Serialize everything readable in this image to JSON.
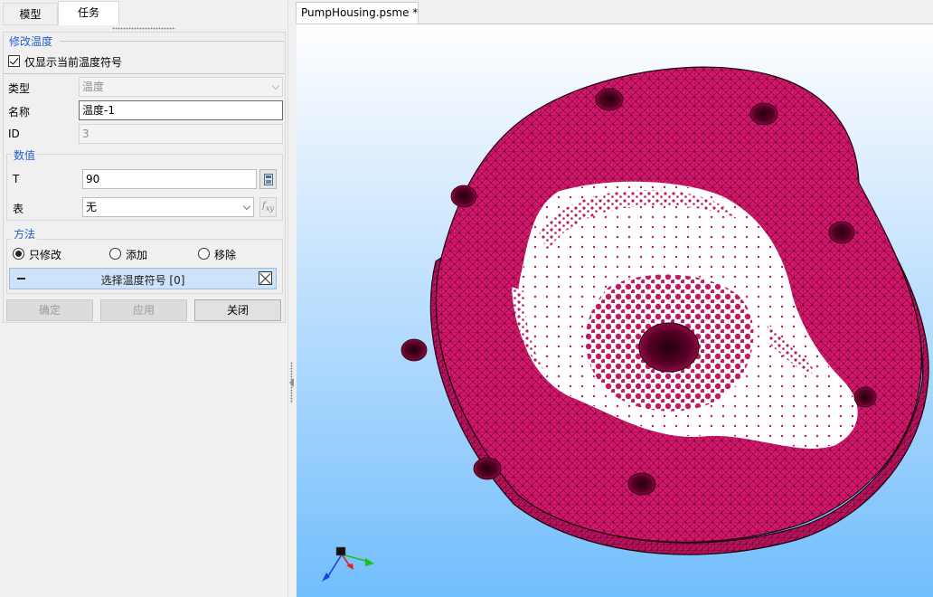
{
  "tabs": {
    "model": "模型",
    "task": "任务"
  },
  "modify_temperature": {
    "section_title": "修改温度",
    "only_current_label": "仅显示当前温度符号",
    "only_current_checked": true,
    "type_label": "类型",
    "type_value": "温度",
    "name_label": "名称",
    "name_value": "温度-1",
    "id_label": "ID",
    "id_value": "3"
  },
  "values_group": {
    "title": "数值",
    "t_label": "T",
    "t_value": "90",
    "table_label": "表",
    "table_value": "无"
  },
  "method_group": {
    "title": "方法",
    "options": [
      "只修改",
      "添加",
      "移除"
    ],
    "selected": "只修改",
    "select_bar_label": "选择温度符号 [0]"
  },
  "buttons": {
    "ok": "确定",
    "apply": "应用",
    "close": "关闭"
  },
  "document_tab": "PumpHousing.psme *",
  "colors": {
    "mesh_fill": "#d4176b",
    "mesh_line": "#2b0013",
    "section_title": "#1f5fc7",
    "select_bar": "#cfe3f8",
    "axis_x": "#e02020",
    "axis_y": "#1ec21e",
    "axis_z": "#2040e0"
  }
}
